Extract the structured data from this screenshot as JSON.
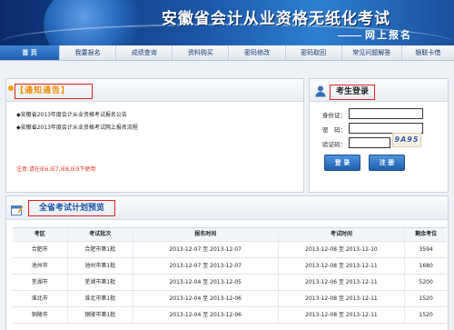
{
  "header": {
    "title": "安徽省会计从业资格无纸化考试",
    "subtitle": "网上报名",
    "brand_color": "#1c57a8"
  },
  "nav": {
    "items": [
      {
        "label": "首 页",
        "active": true
      },
      {
        "label": "我要报名",
        "active": false
      },
      {
        "label": "成绩查询",
        "active": false
      },
      {
        "label": "资料购买",
        "active": false
      },
      {
        "label": "密码修改",
        "active": false
      },
      {
        "label": "密码取回",
        "active": false
      },
      {
        "label": "常见问题解答",
        "active": false
      },
      {
        "label": "银联卡借",
        "active": false
      }
    ]
  },
  "notice": {
    "title": "【通知通告】",
    "items": [
      "◆安徽省2013年度会计从业资格考试报名公告",
      "◆安徽省2013年度会计从业资格考试网上报名流程"
    ],
    "warning": "注意:请在IE6,IE7,IE8,IE9下使用"
  },
  "login": {
    "title": "考生登录",
    "id_label": "身份证：",
    "password_label": "密　码：",
    "captcha_label": "验证码：",
    "captcha_text": "9A95",
    "login_button": "登 录",
    "register_button": "注 册"
  },
  "plan": {
    "title": "全省考试计划预览",
    "columns": [
      "考区",
      "考试批次",
      "报名时间",
      "考试时间",
      "剩余考位"
    ],
    "rows": [
      [
        "合肥市",
        "合肥市第1批",
        "2013-12-07 至 2013-12-07",
        "2013-12-08 至 2013-12-10",
        "3594"
      ],
      [
        "池州市",
        "池州市第1批",
        "2013-12-07 至 2013-12-07",
        "2013-12-08 至 2013-12-11",
        "1680"
      ],
      [
        "芜湖市",
        "芜湖市第1批",
        "2013-12-04 至 2013-12-05",
        "2013-12-06 至 2013-12-11",
        "5200"
      ],
      [
        "淮北市",
        "淮北市第1批",
        "2013-12-04 至 2013-12-06",
        "2013-12-08 至 2013-12-11",
        "1520"
      ],
      [
        "铜陵市",
        "铜陵市第1批",
        "2013-12-04 至 2013-12-06",
        "2013-12-08 至 2013-12-11",
        "1520"
      ]
    ]
  }
}
